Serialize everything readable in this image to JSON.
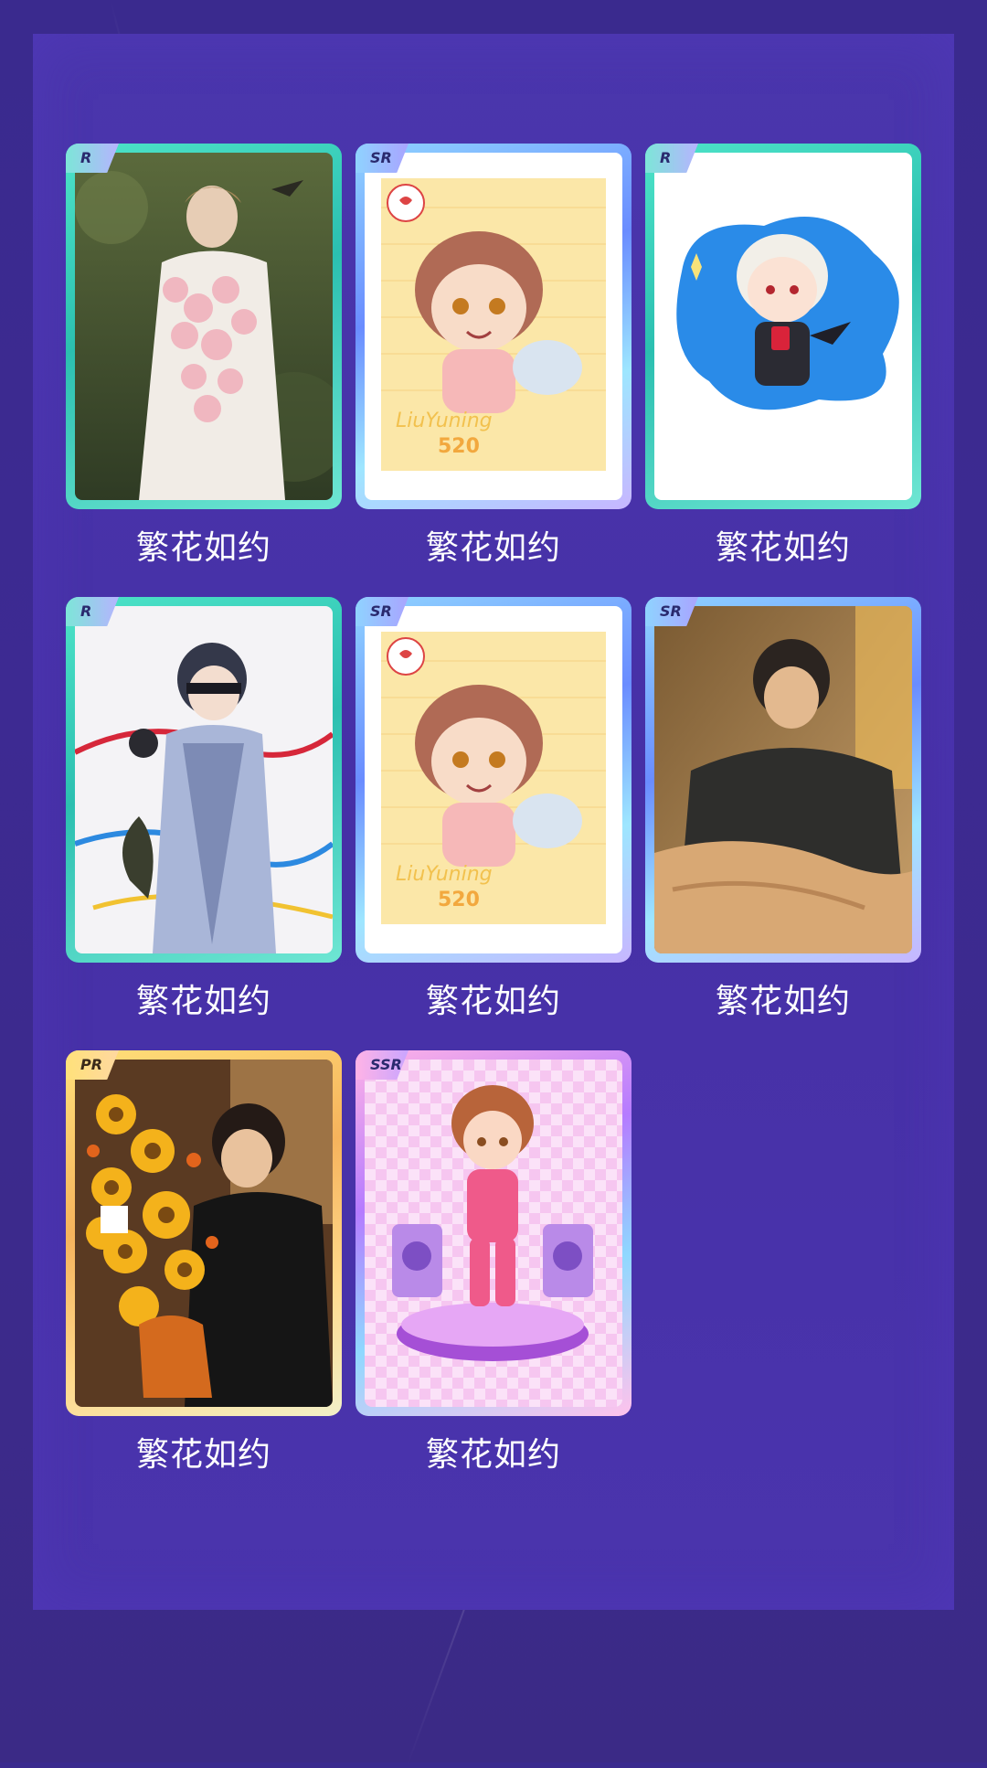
{
  "cards": [
    {
      "rarity": "R",
      "title": "繁花如约",
      "art": "man-with-flowers-painting"
    },
    {
      "rarity": "SR",
      "title": "繁花如约",
      "art": "chibi-liuyuning-520"
    },
    {
      "rarity": "R",
      "title": "繁花如约",
      "art": "chibi-white-hair"
    },
    {
      "rarity": "R",
      "title": "繁花如约",
      "art": "blindfold-armor"
    },
    {
      "rarity": "SR",
      "title": "繁花如约",
      "art": "chibi-liuyuning-520"
    },
    {
      "rarity": "SR",
      "title": "繁花如约",
      "art": "man-in-bed-painting"
    },
    {
      "rarity": "PR",
      "title": "繁花如约",
      "art": "sunflower-bouquet"
    },
    {
      "rarity": "SSR",
      "title": "繁花如约",
      "art": "chibi-stage-pink"
    }
  ],
  "art_text": {
    "chibi_sign": "LiuYuning",
    "chibi_num": "520"
  },
  "colors": {
    "background": "#3d2a92",
    "panel": "#4630a6",
    "caption": "#ffffff",
    "frame_r": "#2bbfb0",
    "frame_sr": "#6a8cff",
    "frame_pr": "#f6b35c",
    "frame_ssr": "#b57bff"
  }
}
